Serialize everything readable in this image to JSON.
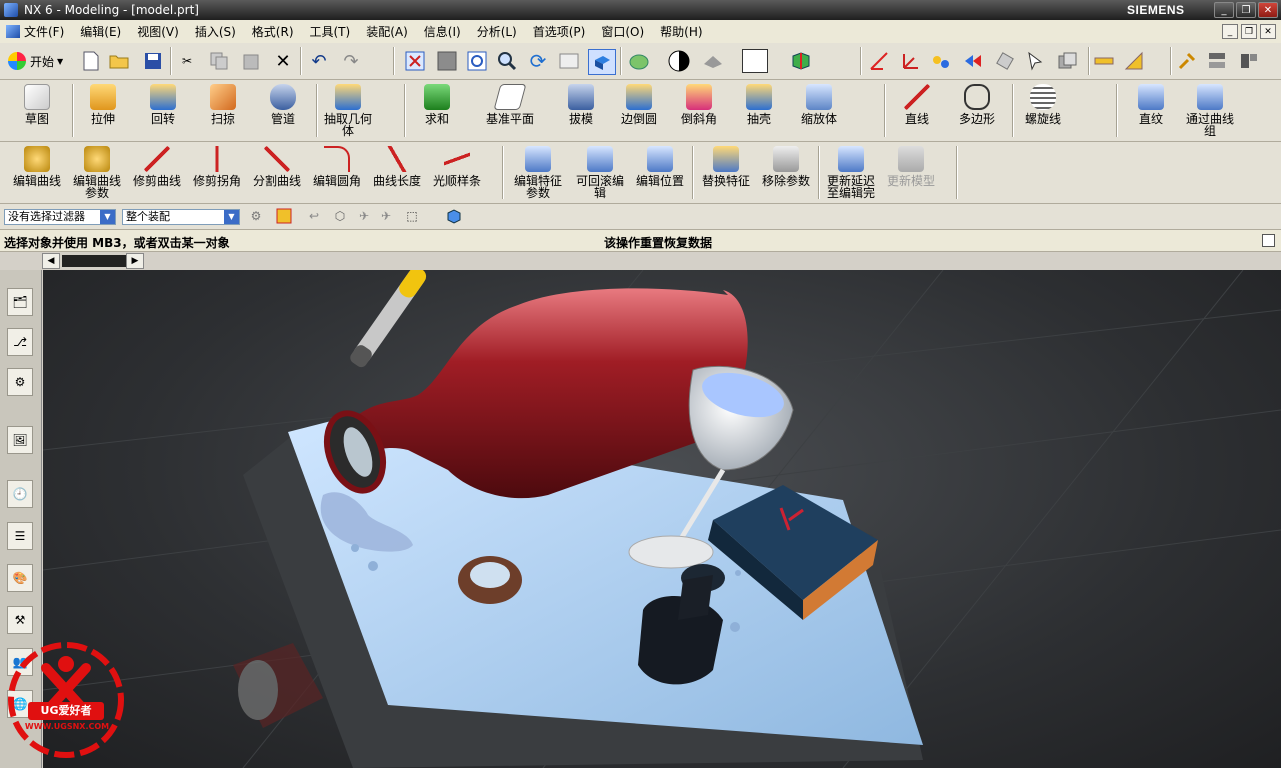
{
  "window": {
    "title": "NX 6 - Modeling - [model.prt]",
    "brand": "SIEMENS",
    "controls": [
      "_",
      "❐",
      "✕"
    ]
  },
  "menu": [
    "文件(F)",
    "编辑(E)",
    "视图(V)",
    "插入(S)",
    "格式(R)",
    "工具(T)",
    "装配(A)",
    "信息(I)",
    "分析(L)",
    "首选项(P)",
    "窗口(O)",
    "帮助(H)"
  ],
  "standard_toolbar": {
    "start_label": "开始",
    "icons": [
      "new-icon",
      "open-icon",
      "save-icon",
      "cut-icon",
      "copy-icon",
      "paste-icon",
      "delete-icon",
      "undo-icon",
      "redo-icon",
      "fit-icon",
      "zoom-icon",
      "rotate-icon",
      "shaded-icon",
      "render-style-icon",
      "color-icon",
      "wcs-icon",
      "measure-icon"
    ]
  },
  "feature_toolbar": {
    "buttons": [
      {
        "label": "草图",
        "icon": "sketch-icon"
      },
      {
        "label": "拉伸",
        "icon": "extrude-icon"
      },
      {
        "label": "回转",
        "icon": "revolve-icon"
      },
      {
        "label": "扫掠",
        "icon": "sweep-icon"
      },
      {
        "label": "管道",
        "icon": "tube-icon"
      },
      {
        "label": "抽取几何\n体",
        "icon": "extract-geometry-icon"
      },
      {
        "label": "求和",
        "icon": "unite-icon"
      },
      {
        "label": "基准平面",
        "icon": "datum-plane-icon"
      },
      {
        "label": "拔模",
        "icon": "draft-icon"
      },
      {
        "label": "边倒圆",
        "icon": "edge-blend-icon"
      },
      {
        "label": "倒斜角",
        "icon": "chamfer-icon"
      },
      {
        "label": "抽壳",
        "icon": "shell-icon"
      },
      {
        "label": "缩放体",
        "icon": "scale-body-icon"
      },
      {
        "label": "直线",
        "icon": "line-icon"
      },
      {
        "label": "多边形",
        "icon": "polygon-icon"
      },
      {
        "label": "螺旋线",
        "icon": "helix-icon"
      },
      {
        "label": "直纹",
        "icon": "ruled-icon"
      },
      {
        "label": "通过曲线\n组",
        "icon": "through-curves-icon"
      }
    ]
  },
  "edit_toolbar": {
    "buttons": [
      {
        "label": "编辑曲线",
        "icon": "edit-curve-icon",
        "enabled": true
      },
      {
        "label": "编辑曲线\n参数",
        "icon": "edit-curve-params-icon",
        "enabled": true
      },
      {
        "label": "修剪曲线",
        "icon": "trim-curve-icon",
        "enabled": true
      },
      {
        "label": "修剪拐角",
        "icon": "trim-corner-icon",
        "enabled": true
      },
      {
        "label": "分割曲线",
        "icon": "divide-curve-icon",
        "enabled": true
      },
      {
        "label": "编辑圆角",
        "icon": "edit-fillet-icon",
        "enabled": true
      },
      {
        "label": "曲线长度",
        "icon": "curve-length-icon",
        "enabled": true
      },
      {
        "label": "光顺样条",
        "icon": "smooth-spline-icon",
        "enabled": true
      },
      {
        "label": "编辑特征\n参数",
        "icon": "edit-feature-params-icon",
        "enabled": true
      },
      {
        "label": "可回滚编\n辑",
        "icon": "rollback-edit-icon",
        "enabled": true
      },
      {
        "label": "编辑位置",
        "icon": "edit-position-icon",
        "enabled": true
      },
      {
        "label": "替换特征",
        "icon": "replace-feature-icon",
        "enabled": true
      },
      {
        "label": "移除参数",
        "icon": "remove-params-icon",
        "enabled": true
      },
      {
        "label": "更新延迟\n至编辑完",
        "icon": "delay-update-icon",
        "enabled": true
      },
      {
        "label": "更新模型",
        "icon": "update-model-icon",
        "enabled": false
      }
    ]
  },
  "selection_bar": {
    "filter": "没有选择过滤器",
    "scope": "整个装配"
  },
  "status": {
    "prompt": "选择对象并使用 MB3，或者双击某一对象",
    "message": "该操作重置恢复数据"
  },
  "resource_bar": [
    "assembly-navigator-icon",
    "constraint-navigator-icon",
    "part-navigator-icon",
    "reuse-library-icon",
    "history-icon",
    "system-materials-icon",
    "palette-icon",
    "roles-icon",
    "web-browser-icon",
    "people-icon"
  ],
  "watermark": {
    "text": "UG爱好者",
    "url": "WWW.UGSNX.COM"
  },
  "colors": {
    "bottle": "#8a1a1f",
    "board": "#9fc6ea",
    "viewport_bg": "#2f3134",
    "watermark": "#e01010"
  }
}
